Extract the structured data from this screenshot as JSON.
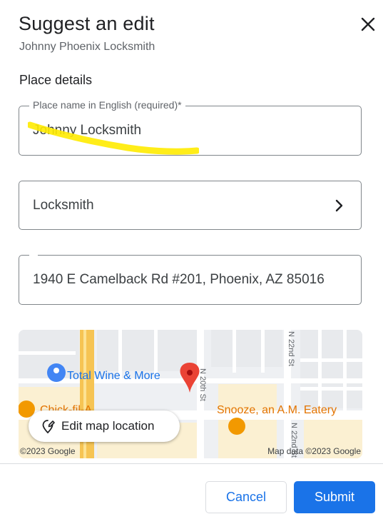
{
  "dialog": {
    "title": "Suggest an edit",
    "subtitle": "Johnny Phoenix Locksmith",
    "close_icon": "close-icon"
  },
  "section": {
    "title": "Place details"
  },
  "fields": {
    "name": {
      "label": "Place name in English (required)*",
      "value": "Johnny Locksmith"
    },
    "category": {
      "value": "Locksmith",
      "icon": "chevron-right-icon"
    },
    "address": {
      "value": "1940 E Camelback Rd #201, Phoenix, AZ 85016"
    }
  },
  "annotation": {
    "color": "#ffeb00"
  },
  "map": {
    "places": [
      "Total Wine & More",
      "Snooze, an A.M. Eatery",
      "Chick-fil-A"
    ],
    "streets": [
      "N 20th St",
      "N 22nd St",
      "N 22nd St"
    ],
    "edit_button": "Edit map location",
    "copyright_left": "©2023 Google",
    "copyright_right": "Map data ©2023 Google"
  },
  "footer": {
    "cancel": "Cancel",
    "submit": "Submit"
  },
  "colors": {
    "primary": "#1a73e8",
    "marker": "#ea4335",
    "poi_orange": "#f29900",
    "poi_blue": "#4285f4"
  }
}
